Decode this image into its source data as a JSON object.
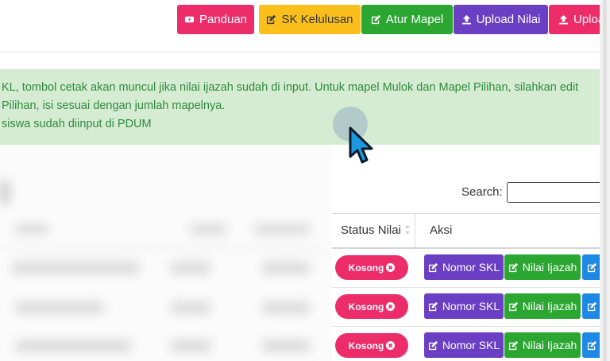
{
  "toolbar": {
    "buttons": [
      {
        "label": "Panduan",
        "icon": "video-icon",
        "color": "#ec2d6a"
      },
      {
        "label": "SK Kelulusan",
        "icon": "edit-icon",
        "color": "#fbbf1b"
      },
      {
        "label": "Atur Mapel",
        "icon": "edit-icon",
        "color": "#2aa631"
      },
      {
        "label": "Upload Nilai",
        "icon": "upload-icon",
        "color": "#6a3fc4"
      },
      {
        "label": "Uploa",
        "icon": "upload-icon",
        "color": "#ec2d6a"
      }
    ]
  },
  "info": {
    "lines": [
      "KL, tombol cetak akan muncul jika nilai ijazah sudah di input. Untuk mapel Mulok dan Mapel Pilihan, silahkan edit",
      " Pilihan, isi sesuai dengan jumlah mapelnya.",
      " siswa sudah diinput di PDUM"
    ]
  },
  "table": {
    "search_label": "Search:",
    "search_value": "",
    "columns": [
      "Status Nilai",
      "Aksi"
    ],
    "rows": [
      {
        "status": "Kosong",
        "actions": [
          "Nomor SKL",
          "Nilai Ijazah",
          ""
        ]
      },
      {
        "status": "Kosong",
        "actions": [
          "Nomor SKL",
          "Nilai Ijazah",
          ""
        ]
      },
      {
        "status": "Kosong",
        "actions": [
          "Nomor SKL",
          "Nilai Ijazah",
          ""
        ]
      }
    ]
  },
  "colors": {
    "info_bg": "#d5ecd3",
    "info_text": "#2f8a3d",
    "danger": "#ec2d6a",
    "warning": "#fbbf1b",
    "success": "#2aa631",
    "purple": "#6a3fc4",
    "info_blue": "#1e88e5"
  }
}
